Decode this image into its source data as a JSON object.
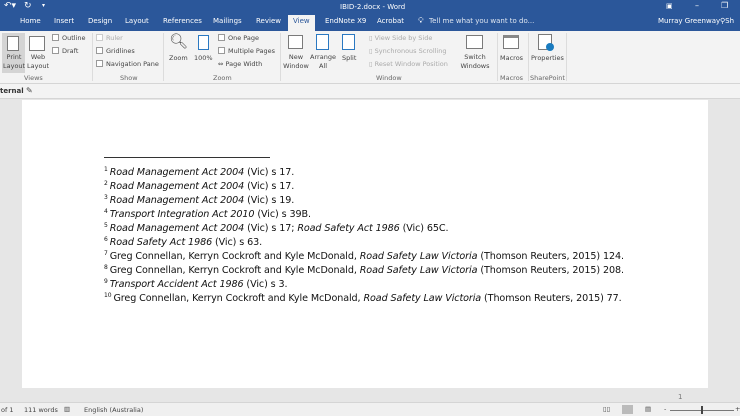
{
  "window": {
    "title": "IBID-2.docx - Word",
    "user": "Murray Greenway",
    "share": "Sh"
  },
  "tabs": [
    "Home",
    "Insert",
    "Design",
    "Layout",
    "References",
    "Mailings",
    "Review",
    "View",
    "EndNote X9",
    "Acrobat"
  ],
  "active_tab": "View",
  "tell_me": "Tell me what you want to do...",
  "ribbon": {
    "views": {
      "print_layout": "Print Layout",
      "web_layout": "Web Layout",
      "outline": "Outline",
      "draft": "Draft",
      "label": "Views"
    },
    "show": {
      "ruler": "Ruler",
      "gridlines": "Gridlines",
      "navigation_pane": "Navigation Pane",
      "label": "Show"
    },
    "zoom": {
      "zoom": "Zoom",
      "hundred": "100%",
      "one_page": "One Page",
      "multiple_pages": "Multiple Pages",
      "page_width": "Page Width",
      "label": "Zoom"
    },
    "window": {
      "new_window": "New Window",
      "arrange_all": "Arrange All",
      "split": "Split",
      "view_side": "View Side by Side",
      "sync_scroll": "Synchronous Scrolling",
      "reset_pos": "Reset Window Position",
      "switch_windows": "Switch Windows",
      "label": "Window"
    },
    "macros": {
      "macros": "Macros",
      "label": "Macros"
    },
    "sharepoint": {
      "properties": "Properties",
      "label": "SharePoint"
    }
  },
  "infobar": {
    "label": "ternal"
  },
  "footnotes": [
    {
      "n": "1",
      "parts": [
        {
          "t": "Road Management Act 2004",
          "i": true
        },
        {
          "t": " (Vic) s 17."
        }
      ]
    },
    {
      "n": "2",
      "parts": [
        {
          "t": "Road Management Act 2004",
          "i": true
        },
        {
          "t": " (Vic) s 17."
        }
      ]
    },
    {
      "n": "3",
      "parts": [
        {
          "t": "Road Management Act 2004",
          "i": true
        },
        {
          "t": " (Vic) s 19."
        }
      ]
    },
    {
      "n": "4",
      "parts": [
        {
          "t": "Transport Integration Act 2010",
          "i": true
        },
        {
          "t": " (Vic) s 39B."
        }
      ]
    },
    {
      "n": "5",
      "parts": [
        {
          "t": "Road Management Act 2004",
          "i": true
        },
        {
          "t": " (Vic) s 17; "
        },
        {
          "t": "Road Safety Act 1986",
          "i": true
        },
        {
          "t": " (Vic) 65C."
        }
      ]
    },
    {
      "n": "6",
      "parts": [
        {
          "t": "Road Safety Act 1986",
          "i": true
        },
        {
          "t": " (Vic) s 63."
        }
      ]
    },
    {
      "n": "7",
      "parts": [
        {
          "t": "Greg Connellan, Kerryn Cockroft and Kyle McDonald, "
        },
        {
          "t": "Road Safety Law Victoria",
          "i": true
        },
        {
          "t": " (Thomson Reuters, 2015) 124."
        }
      ]
    },
    {
      "n": "8",
      "parts": [
        {
          "t": "Greg Connellan, Kerryn Cockroft and Kyle McDonald, "
        },
        {
          "t": "Road Safety Law Victoria",
          "i": true
        },
        {
          "t": " (Thomson Reuters, 2015) 208."
        }
      ]
    },
    {
      "n": "9",
      "parts": [
        {
          "t": "Transport Accident Act 1986",
          "i": true
        },
        {
          "t": " (Vic) s 3."
        }
      ]
    },
    {
      "n": "10",
      "parts": [
        {
          "t": "Greg Connellan, Kerryn Cockroft and Kyle McDonald, "
        },
        {
          "t": "Road Safety Law Victoria",
          "i": true
        },
        {
          "t": " (Thomson Reuters, 2015) 77."
        }
      ]
    }
  ],
  "page_number": "1",
  "status": {
    "pages": "of 1",
    "words": "111 words",
    "language": "English (Australia)",
    "zoom_minus": "-",
    "zoom_plus": "+"
  }
}
